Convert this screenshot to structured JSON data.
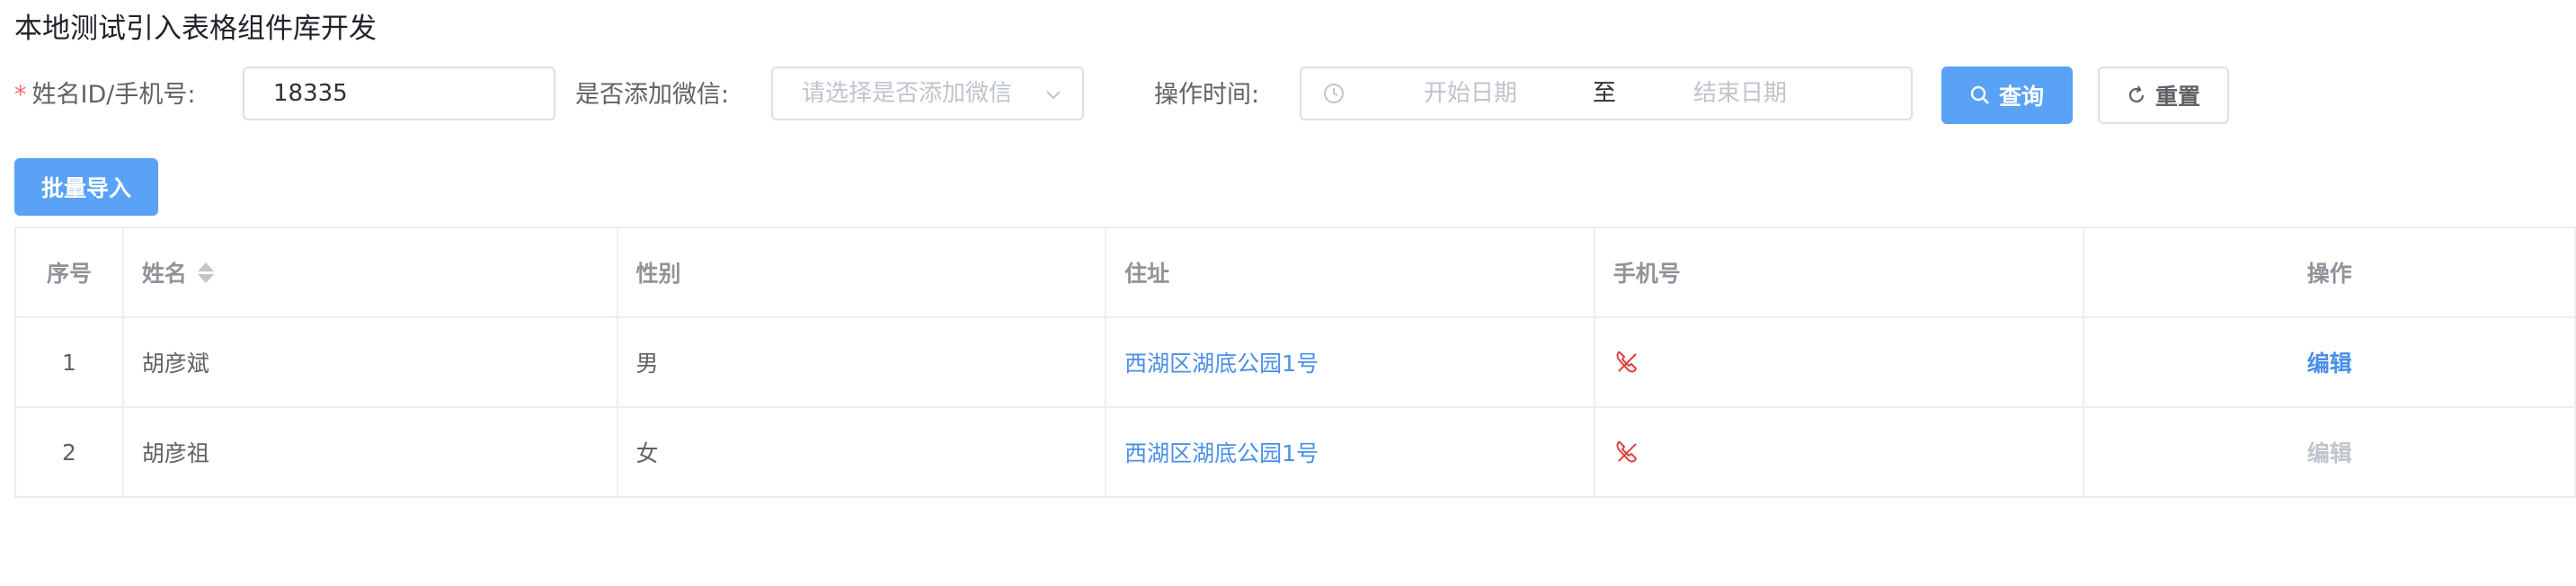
{
  "page": {
    "title": "本地测试引入表格组件库开发"
  },
  "filters": {
    "name_label": "姓名ID/手机号:",
    "required_mark": "*",
    "name_value": "18335",
    "wechat_label": "是否添加微信:",
    "wechat_placeholder": "请选择是否添加微信",
    "time_label": "操作时间:",
    "start_placeholder": "开始日期",
    "range_separator": "至",
    "end_placeholder": "结束日期",
    "query_label": "查询",
    "reset_label": "重置"
  },
  "actions": {
    "import_label": "批量导入"
  },
  "table": {
    "headers": {
      "index": "序号",
      "name": "姓名",
      "gender": "性别",
      "address": "住址",
      "phone": "手机号",
      "operation": "操作"
    },
    "rows": [
      {
        "index": "1",
        "name": "胡彦斌",
        "gender": "男",
        "address": "西湖区湖底公园1号",
        "phone_icon": "phone-icon",
        "edit": "编辑",
        "edit_enabled": true
      },
      {
        "index": "2",
        "name": "胡彦祖",
        "gender": "女",
        "address": "西湖区湖底公园1号",
        "phone_icon": "phone-icon",
        "edit": "编辑",
        "edit_enabled": false
      }
    ]
  },
  "colors": {
    "primary": "#5aa2f6",
    "link": "#4a8fe6",
    "required": "#f56c6c",
    "phone_icon": "#e04040"
  }
}
